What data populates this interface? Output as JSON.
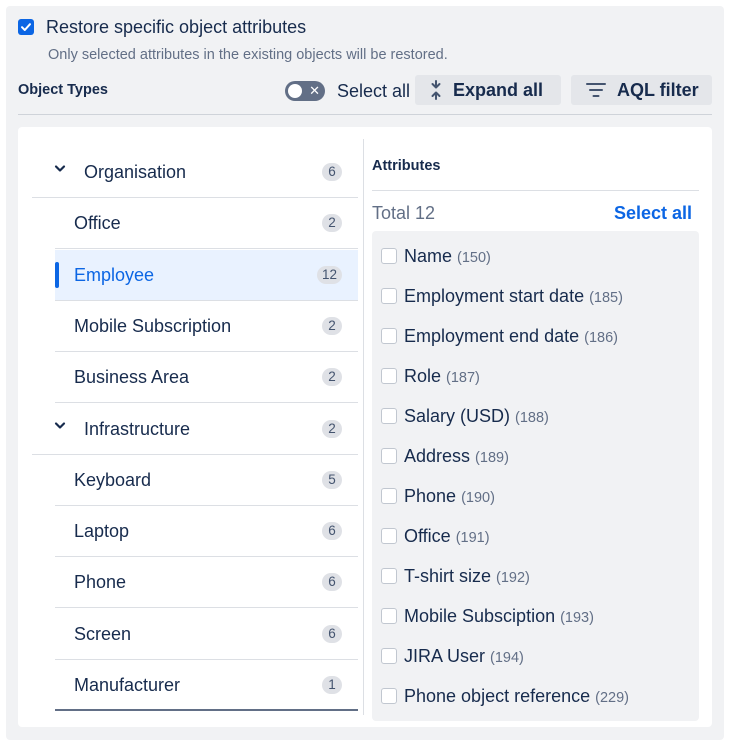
{
  "restore": {
    "label": "Restore specific object attributes",
    "description": "Only selected attributes in the existing objects will be restored.",
    "checked": true
  },
  "toolbar": {
    "title": "Object Types",
    "select_all": "Select all",
    "expand_all": "Expand all",
    "aql_filter": "AQL filter"
  },
  "tree": {
    "items": [
      {
        "type": "group",
        "name": "Organisation",
        "count": "6"
      },
      {
        "type": "child",
        "name": "Office",
        "count": "2"
      },
      {
        "type": "child",
        "name": "Employee",
        "count": "12",
        "selected": true
      },
      {
        "type": "child",
        "name": "Mobile Subscription",
        "count": "2"
      },
      {
        "type": "child",
        "name": "Business Area",
        "count": "2"
      },
      {
        "type": "group",
        "name": "Infrastructure",
        "count": "2"
      },
      {
        "type": "child",
        "name": "Keyboard",
        "count": "5"
      },
      {
        "type": "child",
        "name": "Laptop",
        "count": "6"
      },
      {
        "type": "child",
        "name": "Phone",
        "count": "6"
      },
      {
        "type": "child",
        "name": "Screen",
        "count": "6"
      },
      {
        "type": "child",
        "name": "Manufacturer",
        "count": "1"
      }
    ]
  },
  "attributes": {
    "title": "Attributes",
    "total": "Total 12",
    "select_all": "Select all",
    "items": [
      {
        "name": "Name",
        "id": "(150)"
      },
      {
        "name": "Employment start date",
        "id": "(185)"
      },
      {
        "name": "Employment end date",
        "id": "(186)"
      },
      {
        "name": "Role",
        "id": "(187)"
      },
      {
        "name": "Salary (USD)",
        "id": "(188)"
      },
      {
        "name": "Address",
        "id": "(189)"
      },
      {
        "name": "Phone",
        "id": "(190)"
      },
      {
        "name": "Office",
        "id": "(191)"
      },
      {
        "name": "T-shirt size",
        "id": "(192)"
      },
      {
        "name": "Mobile Subsciption",
        "id": "(193)"
      },
      {
        "name": "JIRA User",
        "id": "(194)"
      },
      {
        "name": "Phone object reference",
        "id": "(229)"
      }
    ]
  },
  "colors": {
    "accent": "#0c66e4",
    "panel_bg": "#f1f2f4",
    "selected_bg": "#e9f2ff"
  }
}
